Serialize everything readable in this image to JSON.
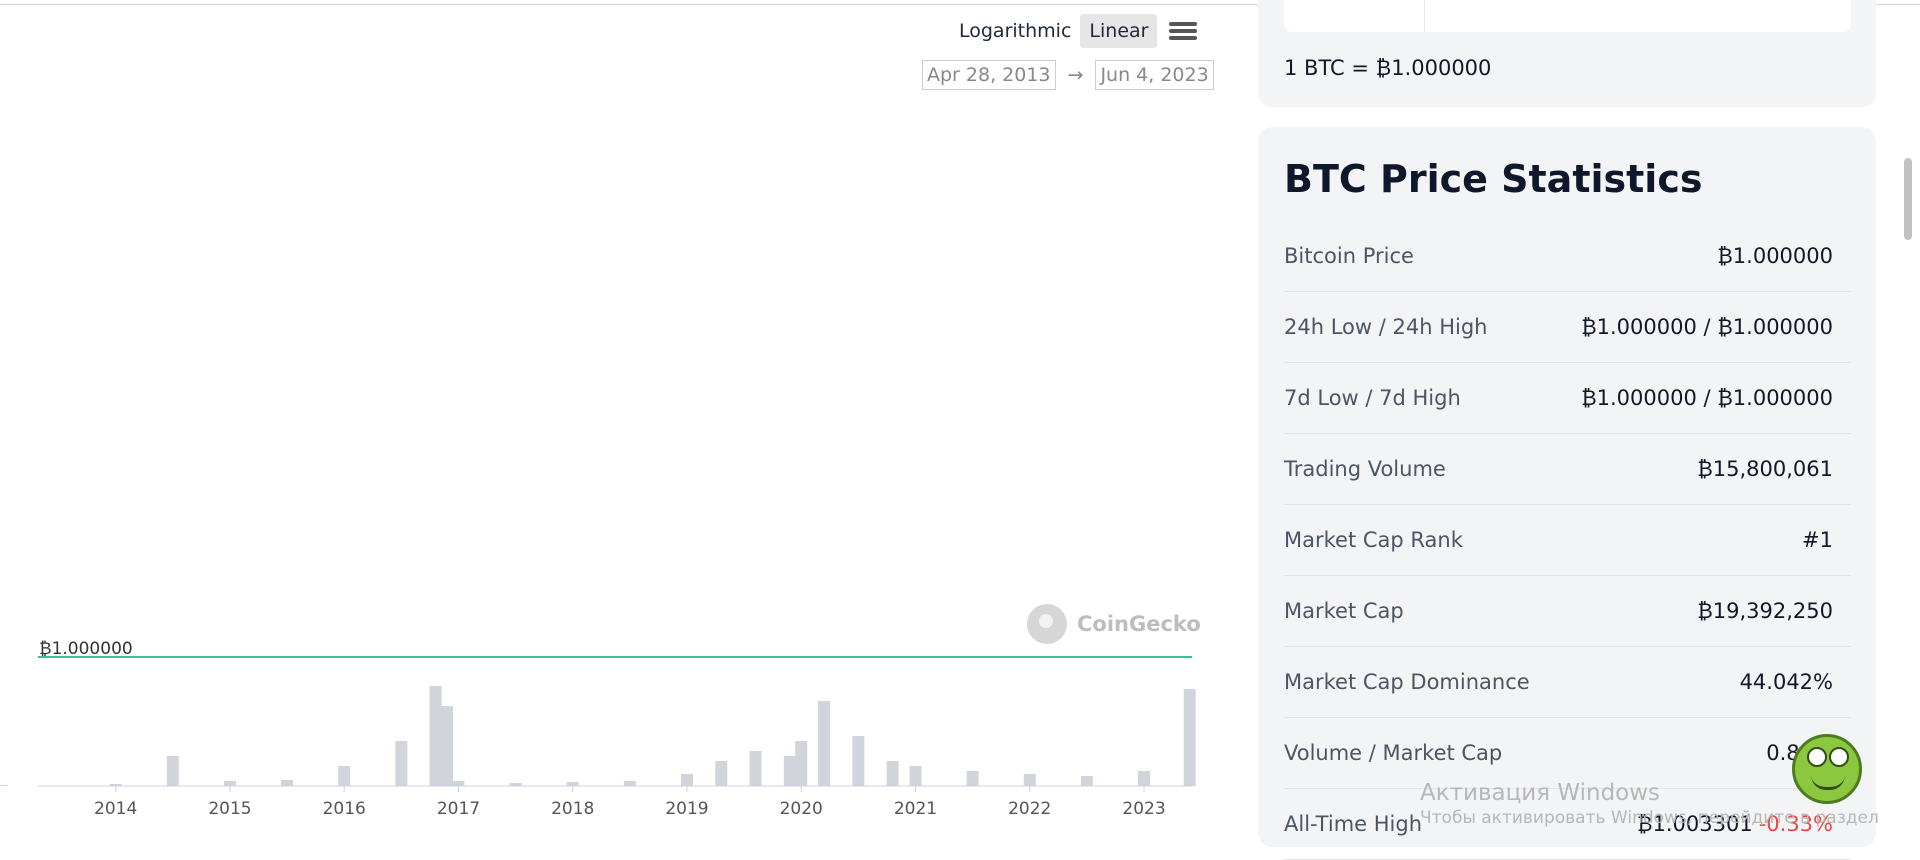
{
  "chart_controls": {
    "scale_options": [
      "Logarithmic",
      "Linear"
    ],
    "active_scale": "Linear",
    "date_from": "Apr 28, 2013",
    "date_to": "Jun 4, 2023",
    "arrow": "→",
    "menu_icon": "hamburger-menu-icon"
  },
  "watermark": {
    "text": "CoinGecko"
  },
  "chart_data": {
    "type": "line",
    "price_line": {
      "label": "₿1.000000",
      "value": 1.0,
      "color": "#3fbf8f"
    },
    "x_ticks": [
      "2014",
      "2015",
      "2016",
      "2017",
      "2018",
      "2019",
      "2020",
      "2021",
      "2022",
      "2023"
    ],
    "volume_series": {
      "type": "bar",
      "color": "#d1d5db",
      "x": [
        "2013",
        "2014",
        "2014.5",
        "2015",
        "2015.5",
        "2016",
        "2016.5",
        "2016.8",
        "2016.9",
        "2017",
        "2017.5",
        "2018",
        "2018.5",
        "2019",
        "2019.3",
        "2019.6",
        "2019.9",
        "2020",
        "2020.2",
        "2020.5",
        "2020.8",
        "2021",
        "2021.5",
        "2022",
        "2022.5",
        "2023",
        "2023.4"
      ],
      "relative_values": [
        0.01,
        0.02,
        0.3,
        0.05,
        0.06,
        0.2,
        0.45,
        1.0,
        0.8,
        0.05,
        0.03,
        0.04,
        0.05,
        0.12,
        0.25,
        0.35,
        0.3,
        0.45,
        0.85,
        0.5,
        0.25,
        0.2,
        0.15,
        0.12,
        0.1,
        0.15,
        0.97
      ]
    }
  },
  "rate": {
    "text": "1 BTC = ₿1.000000"
  },
  "stats": {
    "title": "BTC Price Statistics",
    "rows": [
      {
        "label": "Bitcoin Price",
        "value": "₿1.000000"
      },
      {
        "label": "24h Low / 24h High",
        "value": "₿1.000000 / ₿1.000000"
      },
      {
        "label": "7d Low / 7d High",
        "value": "₿1.000000 / ₿1.000000"
      },
      {
        "label": "Trading Volume",
        "value": "₿15,800,061"
      },
      {
        "label": "Market Cap Rank",
        "value": "#1"
      },
      {
        "label": "Market Cap",
        "value": "₿19,392,250"
      },
      {
        "label": "Market Cap Dominance",
        "value": "44.042%"
      },
      {
        "label": "Volume / Market Cap",
        "value": "0.86..."
      },
      {
        "label": "All-Time High",
        "value": "₿1.003301",
        "change": "-0.33%"
      }
    ]
  },
  "windows_activation": {
    "title": "Активация Windows",
    "subtitle": "Чтобы активировать Windows, перейдите в раздел"
  }
}
